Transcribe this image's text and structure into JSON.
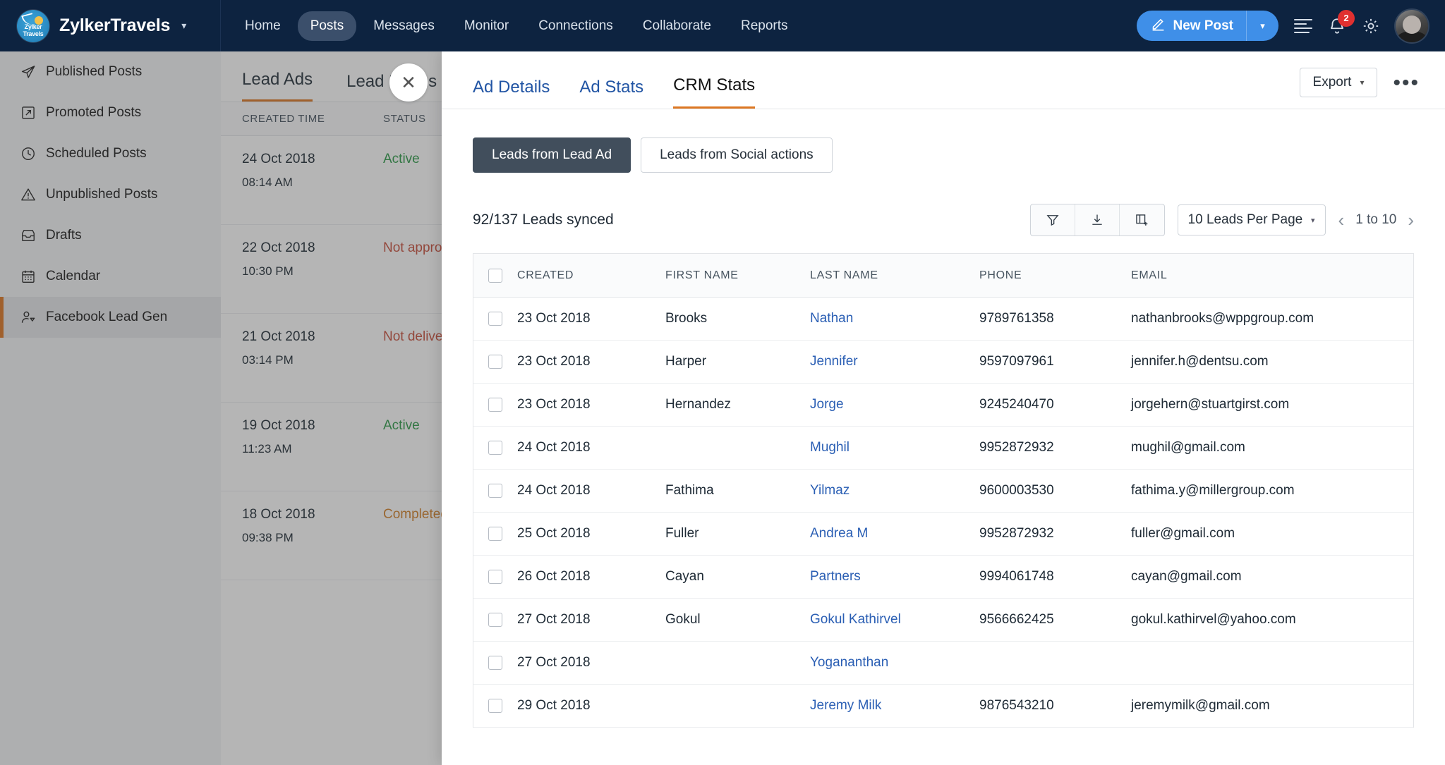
{
  "topnav": {
    "brand": {
      "name": "ZylkerTravels",
      "logo_line1": "Zylker",
      "logo_line2": "Travels",
      "caret": "▾"
    },
    "links": [
      {
        "label": "Home",
        "active": false
      },
      {
        "label": "Posts",
        "active": true
      },
      {
        "label": "Messages",
        "active": false
      },
      {
        "label": "Monitor",
        "active": false
      },
      {
        "label": "Connections",
        "active": false
      },
      {
        "label": "Collaborate",
        "active": false
      },
      {
        "label": "Reports",
        "active": false
      }
    ],
    "new_post": {
      "label": "New Post",
      "caret": "▾"
    },
    "notification_count": "2"
  },
  "sidebar": {
    "items": [
      {
        "label": "Published Posts",
        "icon": "send-icon",
        "active": false
      },
      {
        "label": "Promoted Posts",
        "icon": "external-link-icon",
        "active": false
      },
      {
        "label": "Scheduled Posts",
        "icon": "clock-icon",
        "active": false
      },
      {
        "label": "Unpublished Posts",
        "icon": "warning-icon",
        "active": false
      },
      {
        "label": "Drafts",
        "icon": "inbox-icon",
        "active": false
      },
      {
        "label": "Calendar",
        "icon": "calendar-icon",
        "active": false
      },
      {
        "label": "Facebook Lead Gen",
        "icon": "lead-user-icon",
        "active": true
      }
    ]
  },
  "background_panel": {
    "tabs": [
      {
        "label": "Lead Ads",
        "active": true
      },
      {
        "label": "Lead Forms",
        "active": false
      }
    ],
    "columns": [
      "CREATED TIME",
      "STATUS"
    ],
    "rows": [
      {
        "date": "24 Oct 2018",
        "time": "08:14 AM",
        "status": "Active",
        "status_kind": "active"
      },
      {
        "date": "22 Oct 2018",
        "time": "10:30 PM",
        "status": "Not approved",
        "status_kind": "warn"
      },
      {
        "date": "21 Oct 2018",
        "time": "03:14 PM",
        "status": "Not delivering",
        "status_kind": "warn"
      },
      {
        "date": "19 Oct 2018",
        "time": "11:23 AM",
        "status": "Active",
        "status_kind": "active"
      },
      {
        "date": "18 Oct 2018",
        "time": "09:38 PM",
        "status": "Completed",
        "status_kind": "amber"
      }
    ]
  },
  "modal": {
    "close_label": "✕",
    "tabs": [
      {
        "label": "Ad Details",
        "active": false
      },
      {
        "label": "Ad Stats",
        "active": false
      },
      {
        "label": "CRM Stats",
        "active": true
      }
    ],
    "export": {
      "label": "Export",
      "caret": "▾"
    },
    "more_label": "•••",
    "segments": [
      {
        "label": "Leads from Lead Ad",
        "active": true
      },
      {
        "label": "Leads from Social actions",
        "active": false
      }
    ],
    "toolbar": {
      "synced_text": "92/137 Leads synced",
      "filter_icon": "filter-icon",
      "download_icon": "download-icon",
      "columns_icon": "add-column-icon",
      "per_page": "10 Leads Per Page",
      "per_page_caret": "▾",
      "page_range": "1 to 10",
      "prev_arrow": "‹",
      "next_arrow": "›"
    },
    "table": {
      "columns": [
        "CREATED",
        "FIRST NAME",
        "LAST NAME",
        "PHONE",
        "EMAIL"
      ],
      "rows": [
        {
          "created": "23 Oct 2018",
          "first": "Brooks",
          "last": "Nathan",
          "phone": "9789761358",
          "email": "nathanbrooks@wppgroup.com"
        },
        {
          "created": "23 Oct 2018",
          "first": "Harper",
          "last": "Jennifer",
          "phone": "9597097961",
          "email": "jennifer.h@dentsu.com"
        },
        {
          "created": "23 Oct 2018",
          "first": "Hernandez",
          "last": "Jorge",
          "phone": "9245240470",
          "email": "jorgehern@stuartgirst.com"
        },
        {
          "created": "24 Oct 2018",
          "first": "",
          "last": "Mughil",
          "phone": "9952872932",
          "email": "mughil@gmail.com"
        },
        {
          "created": "24 Oct 2018",
          "first": "Fathima",
          "last": "Yilmaz",
          "phone": "9600003530",
          "email": "fathima.y@millergroup.com"
        },
        {
          "created": "25 Oct 2018",
          "first": "Fuller",
          "last": "Andrea M",
          "phone": "9952872932",
          "email": "fuller@gmail.com"
        },
        {
          "created": "26 Oct 2018",
          "first": "Cayan",
          "last": "Partners",
          "phone": "9994061748",
          "email": "cayan@gmail.com"
        },
        {
          "created": "27 Oct 2018",
          "first": "Gokul",
          "last": "Gokul Kathirvel",
          "phone": "9566662425",
          "email": "gokul.kathirvel@yahoo.com"
        },
        {
          "created": "27 Oct 2018",
          "first": "",
          "last": "Yogananthan",
          "phone": "",
          "email": ""
        },
        {
          "created": "29 Oct 2018",
          "first": "",
          "last": "Jeremy Milk",
          "phone": "9876543210",
          "email": "jeremymilk@gmail.com"
        }
      ]
    }
  },
  "colors": {
    "nav_bg": "#0d2340",
    "accent_orange": "#dd7722",
    "primary_blue": "#3f8fe8",
    "link_blue": "#2b5fb4",
    "status_active": "#2e9c4a",
    "status_warn": "#c94f3d",
    "status_amber": "#d2822a",
    "segment_active": "#414e5c"
  }
}
